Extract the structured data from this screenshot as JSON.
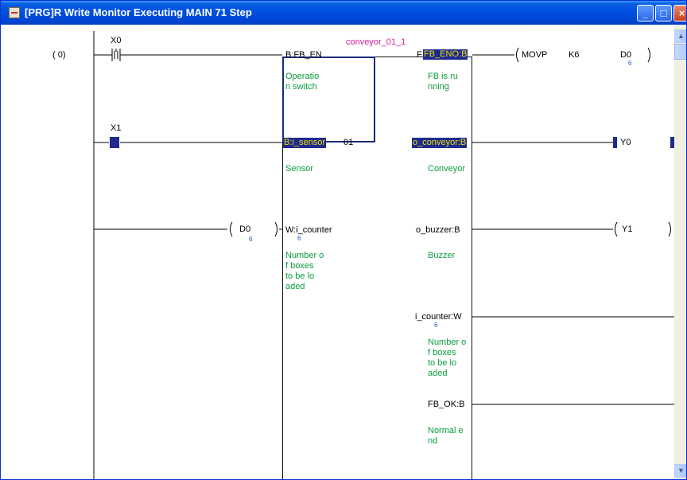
{
  "window": {
    "title": "[PRG]R Write Monitor Executing MAIN 71 Step",
    "minimize_glyph": "_",
    "maximize_glyph": "□",
    "close_glyph": "×",
    "scroll_up_glyph": "▲",
    "scroll_down_glyph": "▼"
  },
  "ladder": {
    "step_number": "(    0)",
    "contact_x0": "X0",
    "contact_x1": "X1",
    "compare_d0": "D0",
    "compare_d0_value": "6",
    "fb_instance": "conveyor_01_1",
    "inputs": [
      {
        "label": "B:FB_EN",
        "comment": "Operatio\nn switch"
      },
      {
        "label": "B:i_sensor",
        "comment": "Sensor"
      },
      {
        "label": "W:i_counter",
        "value": "6",
        "comment": "Number o\nf boxes\nto be lo\naded"
      }
    ],
    "input_suffix_sensor": "01",
    "outputs": [
      {
        "label": "FB_ENO:B",
        "comment": "FB is ru\nnning"
      },
      {
        "label": "o_conveyor:B",
        "comment": "Conveyor"
      },
      {
        "label": "o_buzzer:B",
        "comment": "Buzzer"
      },
      {
        "label": "i_counter:W",
        "value": "6",
        "comment": "Number o\nf boxes\nto be lo\naded"
      },
      {
        "label": "FB_OK:B",
        "comment": "Normal e\nnd"
      }
    ],
    "movp_instruction": "MOVP",
    "movp_source": "K6",
    "movp_dest": "D0",
    "movp_dest_value": "6",
    "coil_y0": "Y0",
    "coil_y1": "Y1"
  },
  "colors": {
    "title_bar": "#0052e3",
    "comment_green": "#0a9c3c",
    "highlight_bg": "#1f2a8f",
    "highlight_fg": "#e7e000",
    "instance_pink": "#d0209c",
    "value_blue": "#2a55c8"
  }
}
